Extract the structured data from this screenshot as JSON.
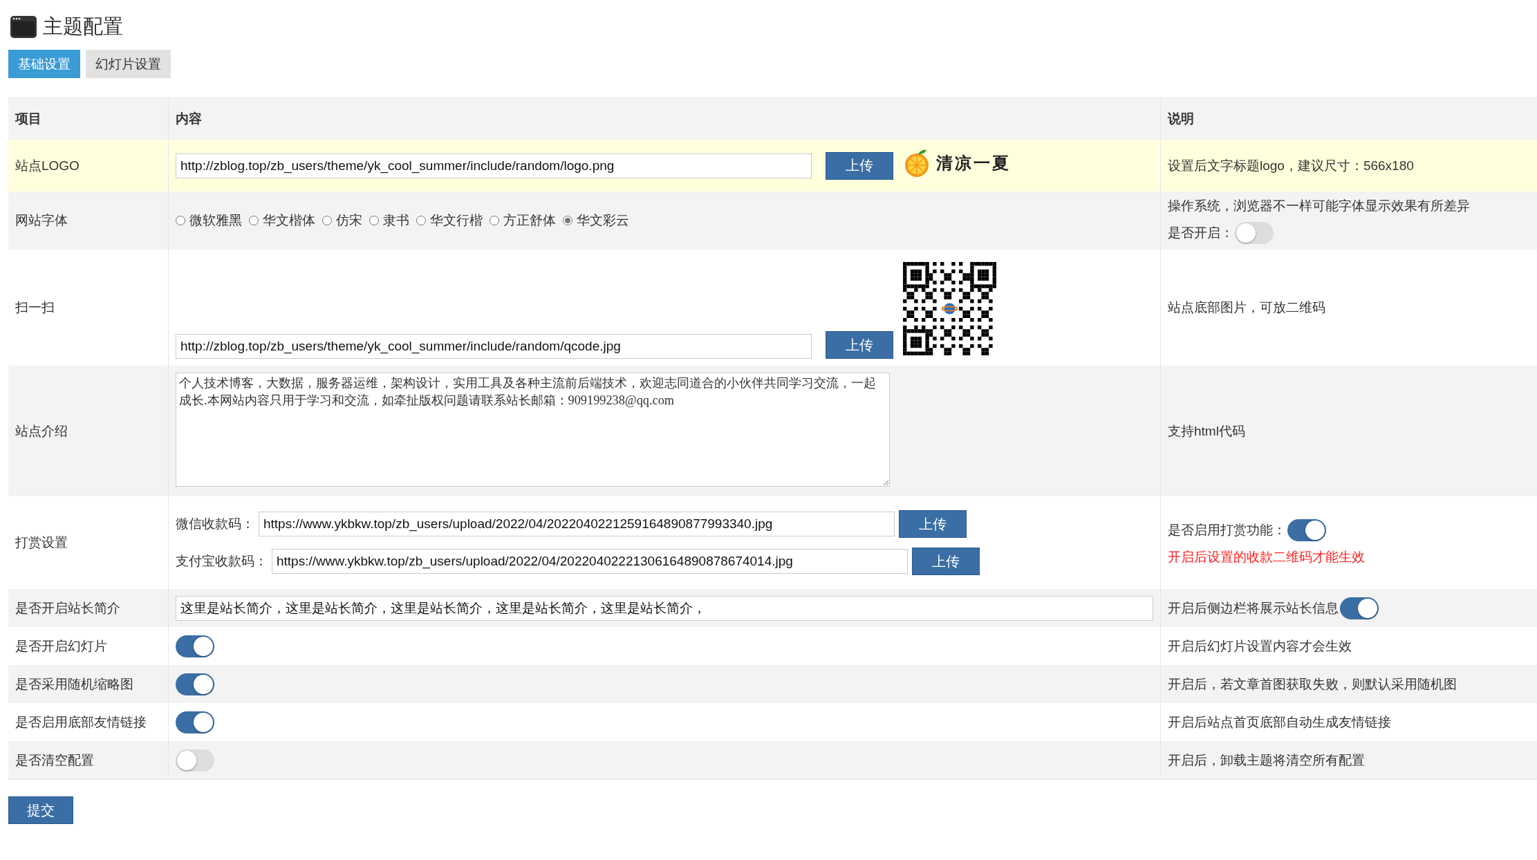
{
  "page_title": "主题配置",
  "tabs": [
    {
      "label": "基础设置",
      "selected": true
    },
    {
      "label": "幻灯片设置",
      "selected": false
    }
  ],
  "table": {
    "columns": [
      "项目",
      "内容",
      "说明"
    ],
    "rows": [
      {
        "label": "站点LOGO",
        "highlighted": true,
        "content": {
          "kind": "upload",
          "value": "http://zblog.top/zb_users/theme/yk_cool_summer/include/random/logo.png",
          "button": "上传",
          "image": {
            "kind": "logo",
            "text": "清凉一夏"
          }
        },
        "notes": [
          {
            "kind": "text",
            "text": "设置后文字标题logo，建议尺寸：566x180"
          }
        ]
      },
      {
        "label": "网站字体",
        "highlighted": false,
        "content": {
          "kind": "radio",
          "options": [
            {
              "label": "微软雅黑",
              "selected": false
            },
            {
              "label": "华文楷体",
              "selected": false
            },
            {
              "label": "仿宋",
              "selected": false
            },
            {
              "label": "隶书",
              "selected": false
            },
            {
              "label": "华文行楷",
              "selected": false
            },
            {
              "label": "方正舒体",
              "selected": false
            },
            {
              "label": "华文彩云",
              "selected": true
            }
          ]
        },
        "notes": [
          {
            "kind": "text",
            "text": "操作系统，浏览器不一样可能字体显示效果有所差异"
          },
          {
            "kind": "toggle",
            "label": "是否开启：",
            "on": false
          }
        ]
      },
      {
        "label": "扫一扫",
        "highlighted": false,
        "content": {
          "kind": "upload",
          "value": "http://zblog.top/zb_users/theme/yk_cool_summer/include/random/qcode.jpg",
          "button": "上传",
          "image": {
            "kind": "qrcode"
          }
        },
        "notes": [
          {
            "kind": "text",
            "text": "站点底部图片，可放二维码"
          }
        ]
      },
      {
        "label": "站点介绍",
        "highlighted": false,
        "content": {
          "kind": "textarea",
          "value": "个人技术博客，大数据，服务器运维，架构设计，实用工具及各种主流前后端技术，欢迎志同道合的小伙伴共同学习交流，一起成长.本网站内容只用于学习和交流，如牵扯版权问题请联系站长邮箱：909199238@qq.com"
        },
        "notes": [
          {
            "kind": "text",
            "text": "支持html代码"
          }
        ]
      },
      {
        "label": "打赏设置",
        "highlighted": false,
        "content": {
          "kind": "payment",
          "fields": [
            {
              "label": "微信收款码：",
              "value": "https://www.ykbkw.top/zb_users/upload/2022/04/2022040221259164890877993340.jpg",
              "button": "上传"
            },
            {
              "label": "支付宝收款码：",
              "value": "https://www.ykbkw.top/zb_users/upload/2022/04/20220402221306164890878674014.jpg",
              "button": "上传"
            }
          ]
        },
        "notes": [
          {
            "kind": "toggle",
            "label": "是否启用打赏功能：",
            "on": true
          },
          {
            "kind": "warning",
            "text": "开启后设置的收款二维码才能生效"
          }
        ]
      },
      {
        "label": "是否开启站长简介",
        "highlighted": false,
        "content": {
          "kind": "input",
          "value": "这里是站长简介，这里是站长简介，这里是站长简介，这里是站长简介，这里是站长简介，"
        },
        "notes": [
          {
            "kind": "toggle",
            "label": "开启后侧边栏将展示站长信息",
            "on": true
          }
        ]
      },
      {
        "label": "是否开启幻灯片",
        "highlighted": false,
        "content": {
          "kind": "switch",
          "on": true
        },
        "notes": [
          {
            "kind": "text",
            "text": "开启后幻灯片设置内容才会生效"
          }
        ]
      },
      {
        "label": "是否采用随机缩略图",
        "highlighted": false,
        "content": {
          "kind": "switch",
          "on": true
        },
        "notes": [
          {
            "kind": "text",
            "text": "开启后，若文章首图获取失败，则默认采用随机图"
          }
        ]
      },
      {
        "label": "是否启用底部友情链接",
        "highlighted": false,
        "content": {
          "kind": "switch",
          "on": true
        },
        "notes": [
          {
            "kind": "text",
            "text": "开启后站点首页底部自动生成友情链接"
          }
        ]
      },
      {
        "label": "是否清空配置",
        "highlighted": false,
        "content": {
          "kind": "switch",
          "on": false
        },
        "notes": [
          {
            "kind": "text",
            "text": "开启后，卸载主题将清空所有配置"
          }
        ]
      }
    ]
  },
  "submit": "提交"
}
